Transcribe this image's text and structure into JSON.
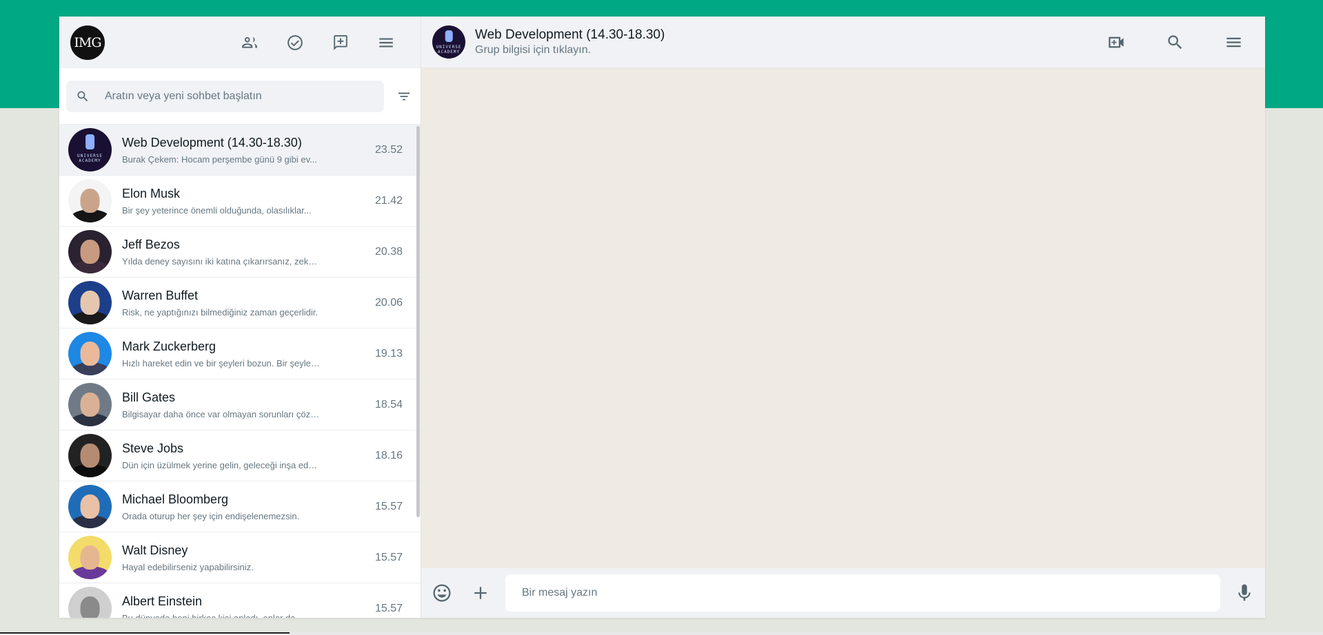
{
  "sidebar": {
    "logo_text": "IMG",
    "actions": [
      {
        "icon": "community-icon"
      },
      {
        "icon": "status-icon"
      },
      {
        "icon": "new-chat-icon"
      },
      {
        "icon": "menu-icon"
      }
    ],
    "search_placeholder": "Aratın veya yeni sohbet başlatın",
    "chats": [
      {
        "name": "Web Development (14.30-18.30)",
        "preview": "Burak Çekem: Hocam perşembe günü 9 gibi ev...",
        "time": "23.52",
        "active": true,
        "avatar_text": "UNIVERSE ACADEMY"
      },
      {
        "name": "Elon Musk",
        "preview": "Bir şey yeterince önemli olduğunda, olasılıklar...",
        "time": "21.42"
      },
      {
        "name": "Jeff Bezos",
        "preview": "Yılda deney sayısını iki katına çıkarırsanız, zekanızı...",
        "time": "20.38"
      },
      {
        "name": "Warren Buffet",
        "preview": "Risk, ne yaptığınızı bilmediğiniz zaman geçerlidir.",
        "time": "20.06"
      },
      {
        "name": "Mark Zuckerberg",
        "preview": "Hızlı hareket edin ve bir şeyleri bozun. Bir şeyleri bo..",
        "time": "19.13"
      },
      {
        "name": "Bill Gates",
        "preview": "Bilgisayar daha önce var olmayan sorunları çözmek...",
        "time": "18.54"
      },
      {
        "name": "Steve Jobs",
        "preview": "Dün için üzülmek yerine gelin, geleceği inşa edelim.",
        "time": "18.16"
      },
      {
        "name": "Michael Bloomberg",
        "preview": "Orada oturup her şey için endişelenemezsin.",
        "time": "15.57"
      },
      {
        "name": "Walt Disney",
        "preview": "Hayal edebilirseniz yapabilirsiniz.",
        "time": "15.57"
      },
      {
        "name": "Albert Einstein",
        "preview": "Bu dünyada beni birkaç kişi anladı, onlar da...",
        "time": "15.57"
      }
    ]
  },
  "conversation": {
    "title": "Web Development (14.30-18.30)",
    "subtitle": "Grup bilgisi için tıklayın.",
    "avatar_text": "UNIVERSE ACADEMY",
    "actions": [
      {
        "icon": "video-call-icon"
      },
      {
        "icon": "search-icon"
      },
      {
        "icon": "menu-icon"
      }
    ]
  },
  "composer": {
    "placeholder": "Bir mesaj yazın",
    "emoji_icon": "emoji-icon",
    "attach_icon": "plus-icon",
    "mic_icon": "mic-icon"
  },
  "colors": {
    "accent": "#00a884",
    "header_bg": "#f0f2f5",
    "chat_bg": "#efeae2"
  }
}
